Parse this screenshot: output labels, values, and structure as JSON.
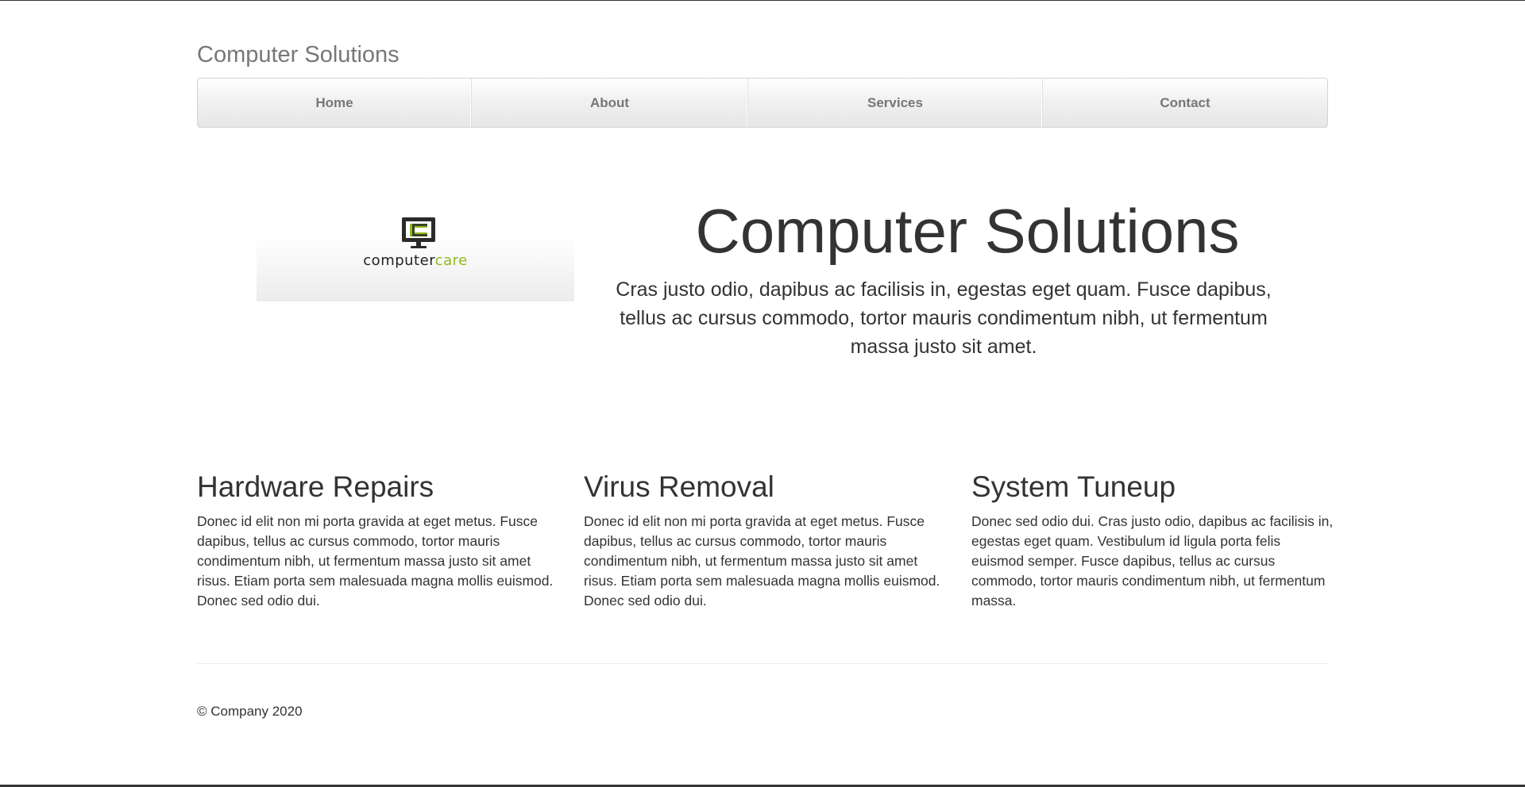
{
  "header": {
    "site_title": "Computer Solutions"
  },
  "nav": {
    "items": [
      {
        "label": "Home"
      },
      {
        "label": "About"
      },
      {
        "label": "Services"
      },
      {
        "label": "Contact"
      }
    ]
  },
  "hero": {
    "logo": {
      "text_dark": "computer",
      "text_accent": "care",
      "icon": "monitor-icon",
      "accent_color": "#8dbb1f"
    },
    "title": "Computer Solutions",
    "lead": "Cras justo odio, dapibus ac facilisis in, egestas eget quam. Fusce dapibus, tellus ac cursus commodo, tortor mauris condimentum nibh, ut fermentum massa justo sit amet."
  },
  "columns": [
    {
      "heading": "Hardware Repairs",
      "body": "Donec id elit non mi porta gravida at eget metus. Fusce dapibus, tellus ac cursus commodo, tortor mauris condimentum nibh, ut fermentum massa justo sit amet risus. Etiam porta sem malesuada magna mollis euismod. Donec sed odio dui."
    },
    {
      "heading": "Virus Removal",
      "body": "Donec id elit non mi porta gravida at eget metus. Fusce dapibus, tellus ac cursus commodo, tortor mauris condimentum nibh, ut fermentum massa justo sit amet risus. Etiam porta sem malesuada magna mollis euismod. Donec sed odio dui."
    },
    {
      "heading": "System Tuneup",
      "body": "Donec sed odio dui. Cras justo odio, dapibus ac facilisis in, egestas eget quam. Vestibulum id ligula porta felis euismod semper. Fusce dapibus, tellus ac cursus commodo, tortor mauris condimentum nibh, ut fermentum massa."
    }
  ],
  "footer": {
    "text": "© Company 2020"
  }
}
